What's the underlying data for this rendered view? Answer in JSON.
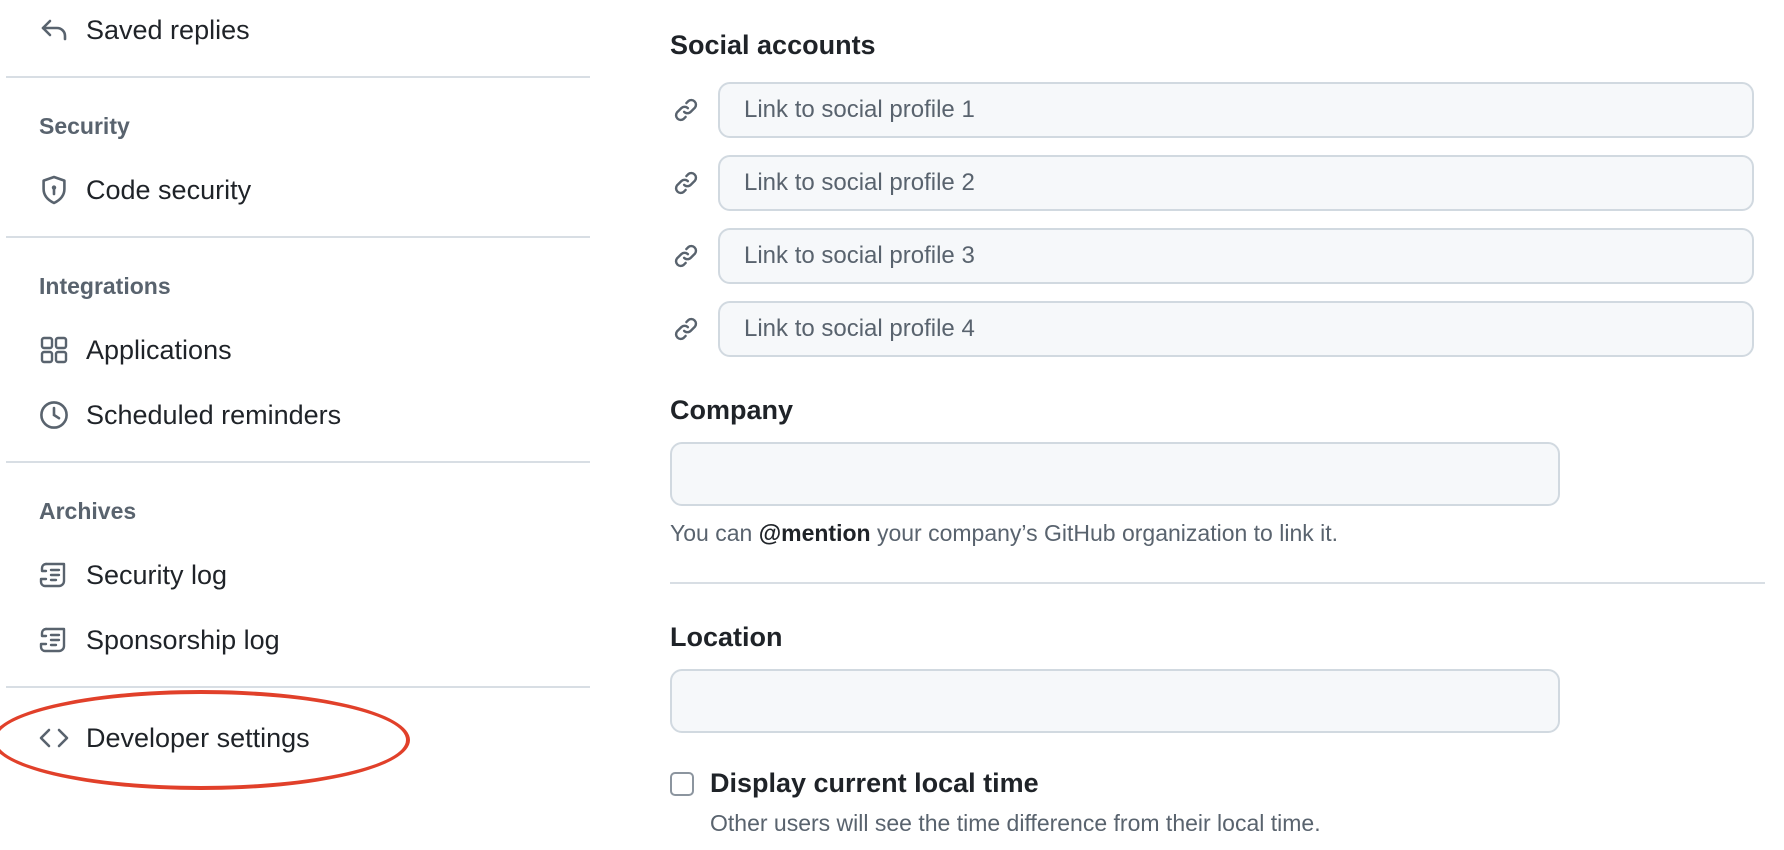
{
  "sidebar": {
    "saved_replies": "Saved replies",
    "security_heading": "Security",
    "code_security": "Code security",
    "integrations_heading": "Integrations",
    "applications": "Applications",
    "scheduled_reminders": "Scheduled reminders",
    "archives_heading": "Archives",
    "security_log": "Security log",
    "sponsorship_log": "Sponsorship log",
    "developer_settings": "Developer settings"
  },
  "social_accounts": {
    "label": "Social accounts",
    "links": [
      {
        "placeholder": "Link to social profile 1",
        "value": ""
      },
      {
        "placeholder": "Link to social profile 2",
        "value": ""
      },
      {
        "placeholder": "Link to social profile 3",
        "value": ""
      },
      {
        "placeholder": "Link to social profile 4",
        "value": ""
      }
    ]
  },
  "company": {
    "label": "Company",
    "value": "",
    "note_prefix": "You can ",
    "note_mention": "@mention",
    "note_suffix": " your company’s GitHub organization to link it."
  },
  "location": {
    "label": "Location",
    "value": ""
  },
  "local_time": {
    "label": "Display current local time",
    "help": "Other users will see the time difference from their local time.",
    "checked": false
  },
  "colors": {
    "highlight": "#e1402a",
    "muted_text": "#59636e",
    "input_bg": "#f6f8fa",
    "border": "#d1d9e0"
  }
}
